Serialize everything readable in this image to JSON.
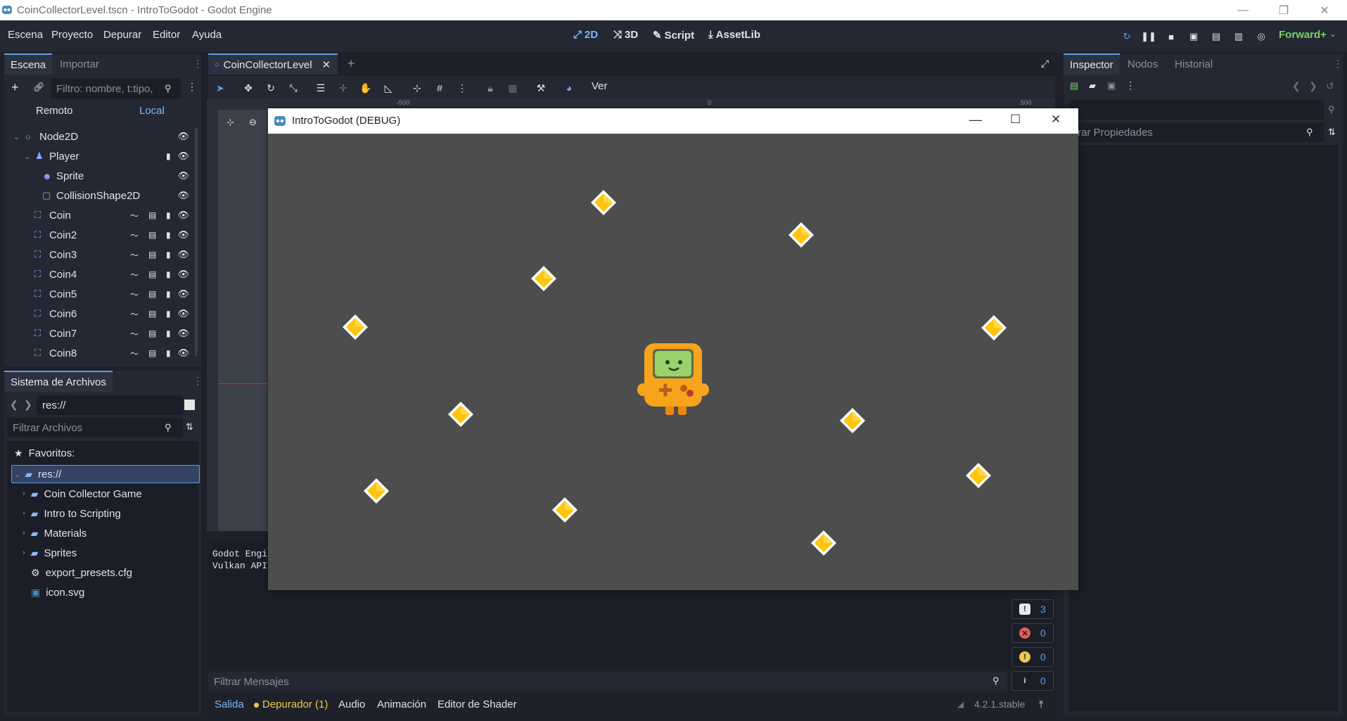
{
  "window": {
    "title": "CoinCollectorLevel.tscn - IntroToGodot - Godot Engine"
  },
  "menu": [
    "Escena",
    "Proyecto",
    "Depurar",
    "Editor",
    "Ayuda"
  ],
  "workspaces": {
    "twod": "2D",
    "threed": "3D",
    "script": "Script",
    "assetlib": "AssetLib"
  },
  "renderer": "Forward+",
  "scene_dock": {
    "tabs": [
      "Escena",
      "Importar"
    ],
    "filter_placeholder": "Filtro: nombre, t:tipo,",
    "remote": "Remoto",
    "local": "Local",
    "nodes": [
      {
        "name": "Node2D"
      },
      {
        "name": "Player"
      },
      {
        "name": "Sprite"
      },
      {
        "name": "CollisionShape2D"
      },
      {
        "name": "Coin"
      },
      {
        "name": "Coin2"
      },
      {
        "name": "Coin3"
      },
      {
        "name": "Coin4"
      },
      {
        "name": "Coin5"
      },
      {
        "name": "Coin6"
      },
      {
        "name": "Coin7"
      },
      {
        "name": "Coin8"
      }
    ]
  },
  "filesystem": {
    "tab": "Sistema de Archivos",
    "path": "res://",
    "filter_placeholder": "Filtrar Archivos",
    "favorites": "Favoritos:",
    "root": "res://",
    "items": [
      "Coin Collector Game",
      "Intro to Scripting",
      "Materials",
      "Sprites",
      "export_presets.cfg",
      "icon.svg"
    ]
  },
  "editor": {
    "scene_tab": "CoinCollectorLevel",
    "view_label": "Ver",
    "ruler_labels": [
      "-500",
      "0",
      "500"
    ]
  },
  "console": {
    "lines": [
      "Godot Engi",
      "Vulkan API"
    ],
    "filter_placeholder": "Filtrar Mensajes",
    "counters": {
      "messages": "3",
      "errors": "0",
      "warnings": "0",
      "info": "0"
    }
  },
  "bottom_tabs": {
    "output": "Salida",
    "debugger": "Depurador (1)",
    "audio": "Audio",
    "animation": "Animación",
    "shader": "Editor de Shader",
    "version": "4.2.1.stable"
  },
  "inspector": {
    "tabs": [
      "Inspector",
      "Nodos",
      "Historial"
    ],
    "filter_placeholder": "trar Propiedades"
  },
  "game_window": {
    "title": "IntroToGodot (DEBUG)"
  },
  "colors": {
    "accent": "#5e9ee6",
    "coin": "#ffc40c",
    "game_bg": "#4d4d4d",
    "debugger_dot": "#f0c84a"
  }
}
